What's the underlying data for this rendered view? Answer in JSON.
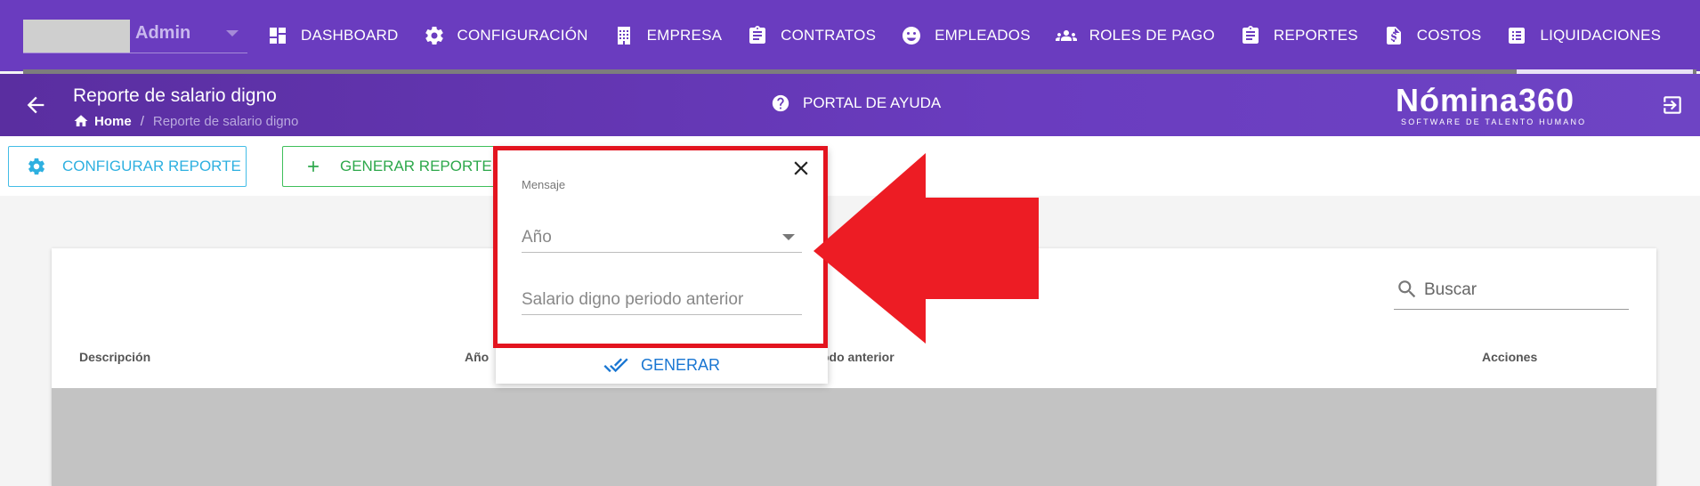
{
  "topnav": {
    "admin_label": "Admin",
    "items": [
      {
        "label": "DASHBOARD",
        "icon": "dashboard-icon"
      },
      {
        "label": "CONFIGURACIÓN",
        "icon": "gear-icon"
      },
      {
        "label": "EMPRESA",
        "icon": "building-icon"
      },
      {
        "label": "CONTRATOS",
        "icon": "clipboard-icon"
      },
      {
        "label": "EMPLEADOS",
        "icon": "face-icon"
      },
      {
        "label": "ROLES DE PAGO",
        "icon": "people-icon"
      },
      {
        "label": "REPORTES",
        "icon": "clipboard-icon"
      },
      {
        "label": "COSTOS",
        "icon": "dollar-file-icon"
      },
      {
        "label": "LIQUIDACIONES",
        "icon": "list-icon"
      }
    ]
  },
  "subheader": {
    "title": "Reporte de salario digno",
    "breadcrumb_home": "Home",
    "breadcrumb_sep": "/",
    "breadcrumb_current": "Reporte de salario digno",
    "help_label": "PORTAL DE AYUDA",
    "brand_name": "Nómina360",
    "brand_tagline": "SOFTWARE DE TALENTO HUMANO"
  },
  "toolbar": {
    "config_label": "CONFIGURAR REPORTE",
    "generate_label": "GENERAR REPORTE"
  },
  "table": {
    "search_placeholder": "Buscar",
    "columns": [
      "Descripción",
      "Año",
      "odo anterior",
      "Acciones"
    ]
  },
  "dialog": {
    "message_label": "Mensaje",
    "year_placeholder": "Año",
    "salario_placeholder": "Salario digno periodo anterior",
    "generate_label": "GENERAR"
  },
  "colors": {
    "nav_bg": "#6a3cbf",
    "accent_config": "#2eb0e0",
    "accent_generate": "#2da84b",
    "dialog_action": "#1976d2",
    "annotation_red": "#e3141f"
  }
}
